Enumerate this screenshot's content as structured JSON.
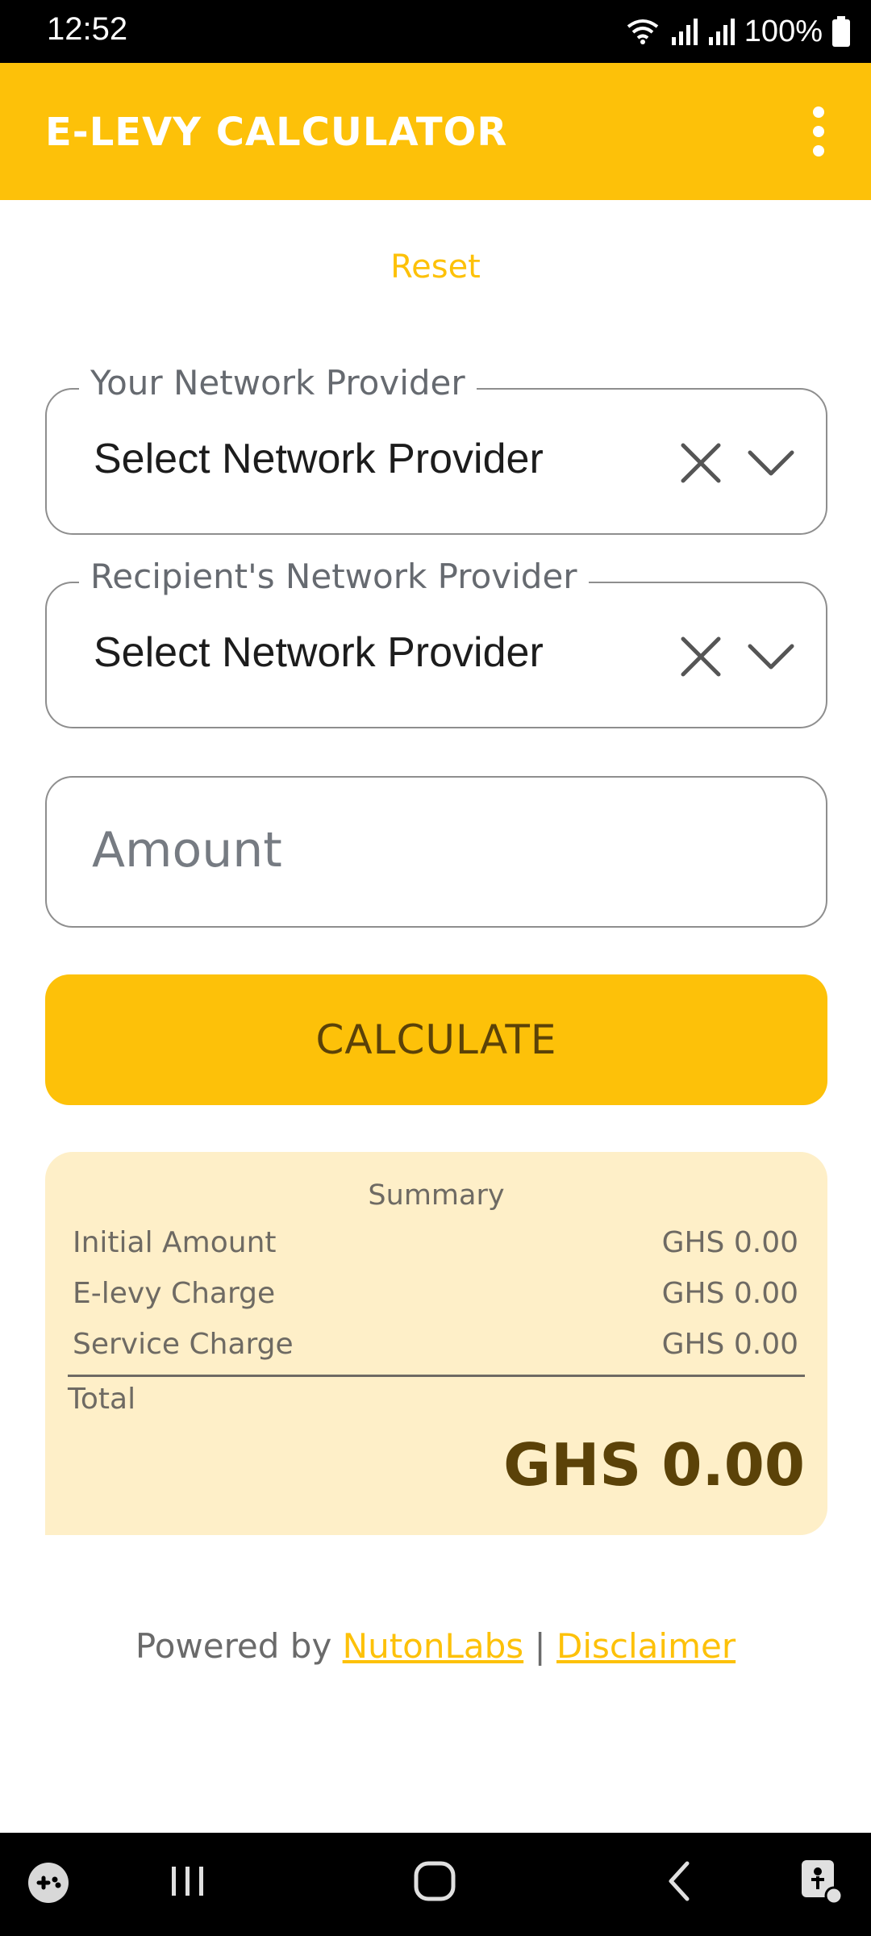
{
  "status_bar": {
    "time": "12:52",
    "battery": "100%"
  },
  "app_bar": {
    "title": "E-LEVY CALCULATOR"
  },
  "reset_label": "Reset",
  "your_provider": {
    "legend": "Your Network Provider",
    "value": "Select Network Provider"
  },
  "recipient_provider": {
    "legend": "Recipient's Network Provider",
    "value": "Select Network Provider"
  },
  "amount": {
    "placeholder": "Amount",
    "value": ""
  },
  "calculate_label": "CALCULATE",
  "summary": {
    "title": "Summary",
    "rows": [
      {
        "label": "Initial Amount",
        "value": "GHS 0.00"
      },
      {
        "label": "E-levy Charge",
        "value": "GHS 0.00"
      },
      {
        "label": "Service Charge",
        "value": "GHS 0.00"
      }
    ],
    "total_label": "Total",
    "total_value": "GHS 0.00"
  },
  "footer": {
    "prefix": "Powered by ",
    "brand_link": "NutonLabs",
    "separator": " | ",
    "disclaimer_link": "Disclaimer"
  },
  "colors": {
    "accent": "#FDC109",
    "summary_bg": "#FEEFC8",
    "button_text": "#5B4208"
  },
  "icons": [
    "wifi-icon",
    "signal-icon",
    "battery-icon",
    "more-vert-icon",
    "clear-icon",
    "chevron-down-icon",
    "game-launcher-icon",
    "recents-icon",
    "home-icon",
    "back-icon",
    "accessibility-icon"
  ]
}
